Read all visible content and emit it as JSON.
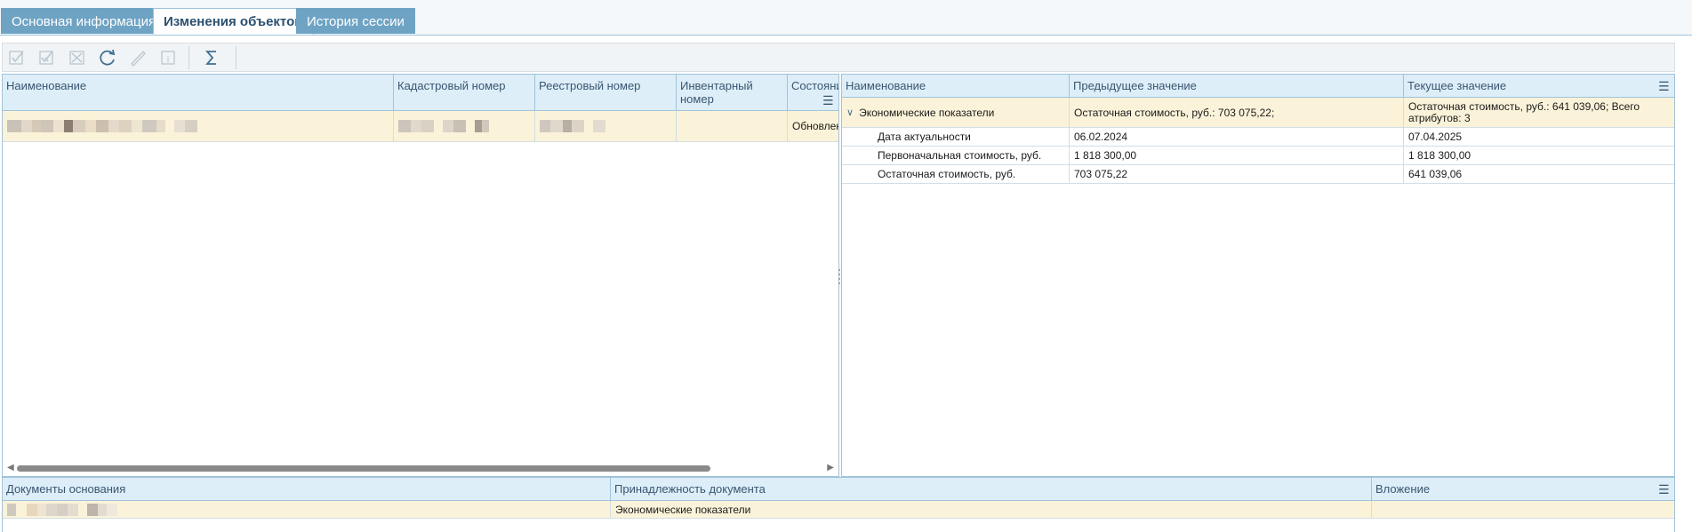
{
  "tabs": [
    {
      "label": "Основная информация",
      "active": false
    },
    {
      "label": "Изменения объектов",
      "active": true
    },
    {
      "label": "История сессии",
      "active": false
    }
  ],
  "toolbar": {
    "icons": [
      "check-icon",
      "check-all-icon",
      "cancel-icon",
      "refresh-icon",
      "edit-icon",
      "info-icon",
      "sum-icon"
    ]
  },
  "objects_grid": {
    "columns": [
      "Наименование",
      "Кадастровый номер",
      "Реестровый номер",
      "Инвентарный номер",
      "Состояние"
    ],
    "rows": [
      {
        "name": "",
        "cadastral": "",
        "registry": "",
        "inventory": "",
        "state": "Обновлен"
      }
    ]
  },
  "changes_grid": {
    "columns": [
      "Наименование",
      "Предыдущее значение",
      "Текущее значение"
    ],
    "group": {
      "name": "Экономические показатели",
      "previous": "Остаточная стоимость, руб.: 703 075,22;",
      "current": "Остаточная стоимость, руб.: 641 039,06; Всего атрибутов: 3"
    },
    "rows": [
      {
        "name": "Дата актуальности",
        "previous": "06.02.2024",
        "current": "07.04.2025"
      },
      {
        "name": "Первоначальная стоимость, руб.",
        "previous": "1 818 300,00",
        "current": "1 818 300,00"
      },
      {
        "name": "Остаточная стоимость, руб.",
        "previous": "703 075,22",
        "current": "641 039,06"
      }
    ]
  },
  "documents_grid": {
    "columns": [
      "Документы основания",
      "Принадлежность документа",
      "Вложение"
    ],
    "rows": [
      {
        "document": "",
        "belongs": "Экономические показатели",
        "attachment": ""
      }
    ]
  },
  "colors": {
    "accent": "#6ea3c4",
    "header_bg": "#ddeef9",
    "selected_row": "#fbf3d9",
    "border": "#9fc3d9"
  }
}
